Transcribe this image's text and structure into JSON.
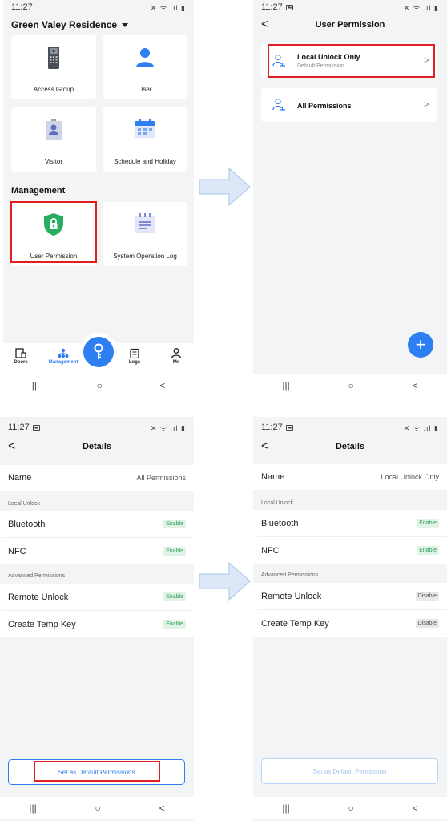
{
  "status": {
    "time": "11:27",
    "icons": "✕ ᯤ .ıl ▮"
  },
  "panel1": {
    "site_title": "Green Valey Residence",
    "tiles": [
      "Access Group",
      "User",
      "Visitor",
      "Schedule and Holiday"
    ],
    "section_title": "Management",
    "mgmt_tiles": [
      "User Permission",
      "System Operation Log"
    ],
    "tabs": [
      "Doors",
      "Management",
      "Logs",
      "Me"
    ]
  },
  "panel2": {
    "title": "User Permission",
    "items": [
      {
        "title": "Local Unlock Only",
        "subtitle": "Default Permission"
      },
      {
        "title": "All Permissions"
      }
    ],
    "add_label": "+"
  },
  "details_common": {
    "title": "Details",
    "name_label": "Name",
    "group_local": "Local Unlock",
    "bluetooth": "Bluetooth",
    "nfc": "NFC",
    "group_advanced": "Advanced Permissions",
    "remote_unlock": "Remote Unlock",
    "temp_key": "Create Temp Key"
  },
  "panel3": {
    "name_value": "All Permissions",
    "bluetooth": "Enable",
    "nfc": "Enable",
    "remote_unlock": "Enable",
    "temp_key": "Enable",
    "button": "Set as Default Permissions"
  },
  "panel4": {
    "name_value": "Local Unlock Only",
    "bluetooth": "Enable",
    "nfc": "Enable",
    "remote_unlock": "Disable",
    "temp_key": "Disable",
    "button": "Set as Default Permission"
  },
  "nav": {
    "recents": "|||",
    "home": "○",
    "back": "<"
  },
  "back_glyph": "<",
  "chevron_glyph": ">",
  "colors": {
    "accent": "#2e7ff2",
    "highlight": "#e02020",
    "enable_bg": "#dff3e6",
    "enable_fg": "#2e9e5b",
    "shield": "#27ae60"
  }
}
